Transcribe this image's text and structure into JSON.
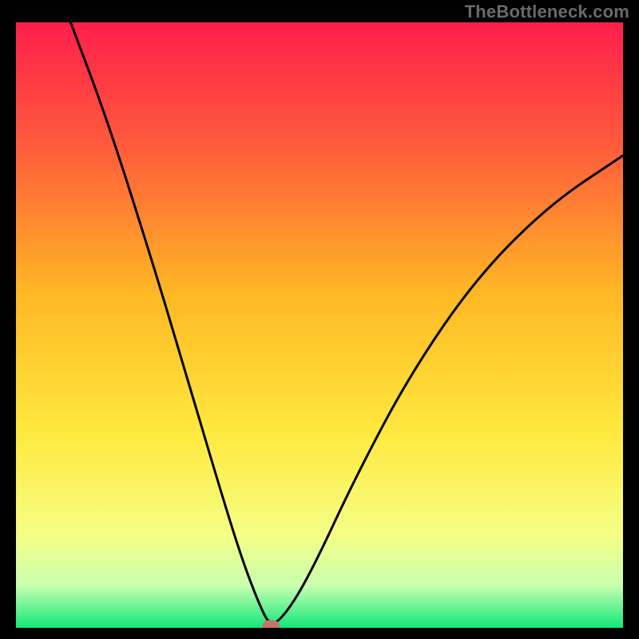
{
  "watermark": "TheBottleneck.com",
  "chart_data": {
    "type": "line",
    "title": "",
    "xlabel": "",
    "ylabel": "",
    "x_range": [
      0,
      100
    ],
    "y_range": [
      0,
      100
    ],
    "curve": {
      "description": "Bottleneck-style V curve with minimum near x≈42",
      "min_x": 42,
      "min_y": 0,
      "points": [
        {
          "x": 9,
          "y": 100
        },
        {
          "x": 15,
          "y": 84
        },
        {
          "x": 22,
          "y": 62
        },
        {
          "x": 28,
          "y": 42
        },
        {
          "x": 33,
          "y": 25
        },
        {
          "x": 37,
          "y": 12
        },
        {
          "x": 40,
          "y": 4
        },
        {
          "x": 42,
          "y": 0
        },
        {
          "x": 45,
          "y": 3
        },
        {
          "x": 49,
          "y": 10
        },
        {
          "x": 56,
          "y": 25
        },
        {
          "x": 65,
          "y": 42
        },
        {
          "x": 76,
          "y": 58
        },
        {
          "x": 88,
          "y": 70
        },
        {
          "x": 100,
          "y": 78
        }
      ]
    },
    "marker": {
      "x": 42,
      "y": 0,
      "color": "#c4746f"
    },
    "gradient_stops": [
      {
        "offset": 0.0,
        "color": "#ff1f4b"
      },
      {
        "offset": 0.2,
        "color": "#ff5a3c"
      },
      {
        "offset": 0.45,
        "color": "#ffb824"
      },
      {
        "offset": 0.68,
        "color": "#ffe93f"
      },
      {
        "offset": 0.85,
        "color": "#f4ff87"
      },
      {
        "offset": 0.93,
        "color": "#c9ffb0"
      },
      {
        "offset": 1.0,
        "color": "#12e87a"
      }
    ]
  }
}
